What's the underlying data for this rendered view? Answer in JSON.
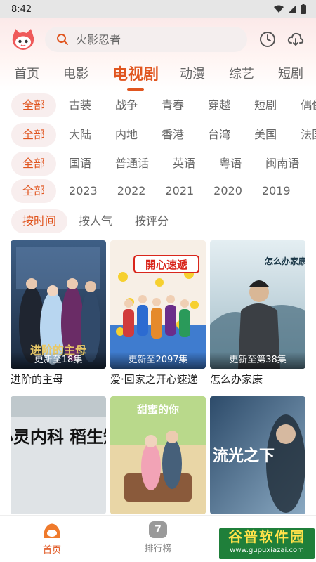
{
  "status_bar": {
    "time": "8:42"
  },
  "search": {
    "placeholder": "火影忍者"
  },
  "tabs": [
    {
      "label": "首页"
    },
    {
      "label": "电影"
    },
    {
      "label": "电视剧",
      "active": true
    },
    {
      "label": "动漫"
    },
    {
      "label": "综艺"
    },
    {
      "label": "短剧"
    }
  ],
  "filters": {
    "genre": [
      "全部",
      "古装",
      "战争",
      "青春",
      "穿越",
      "短剧",
      "偶像"
    ],
    "region": [
      "全部",
      "大陆",
      "内地",
      "香港",
      "台湾",
      "美国",
      "法国"
    ],
    "language": [
      "全部",
      "国语",
      "普通话",
      "英语",
      "粤语",
      "闽南语"
    ],
    "year": [
      "全部",
      "2023",
      "2022",
      "2021",
      "2020",
      "2019"
    ],
    "sort": [
      "按时间",
      "按人气",
      "按评分"
    ]
  },
  "cards": [
    {
      "title": "进阶的主母",
      "badge": "更新至18集",
      "poster_text": "进阶的主母"
    },
    {
      "title": "爱·回家之开心速递",
      "badge": "更新至2097集",
      "poster_text": "開心速遞"
    },
    {
      "title": "怎么办家康",
      "badge": "更新至第38集",
      "poster_text": "怎么办家康"
    },
    {
      "title": "",
      "badge": "",
      "poster_text": "心灵内科 稻生知"
    },
    {
      "title": "",
      "badge": "",
      "poster_text": "甜蜜的你"
    },
    {
      "title": "",
      "badge": "",
      "poster_text": "流光之下"
    }
  ],
  "bottom_nav": [
    {
      "label": "首页",
      "active": true
    },
    {
      "label": "排行榜",
      "badge": "7"
    }
  ],
  "watermark": {
    "big": "谷普软件园",
    "small": "www.gupuxiazai.com"
  },
  "colors": {
    "accent": "#e0551f",
    "chip_bg": "#f8eeee",
    "header_bg": "#fbe9e9"
  }
}
